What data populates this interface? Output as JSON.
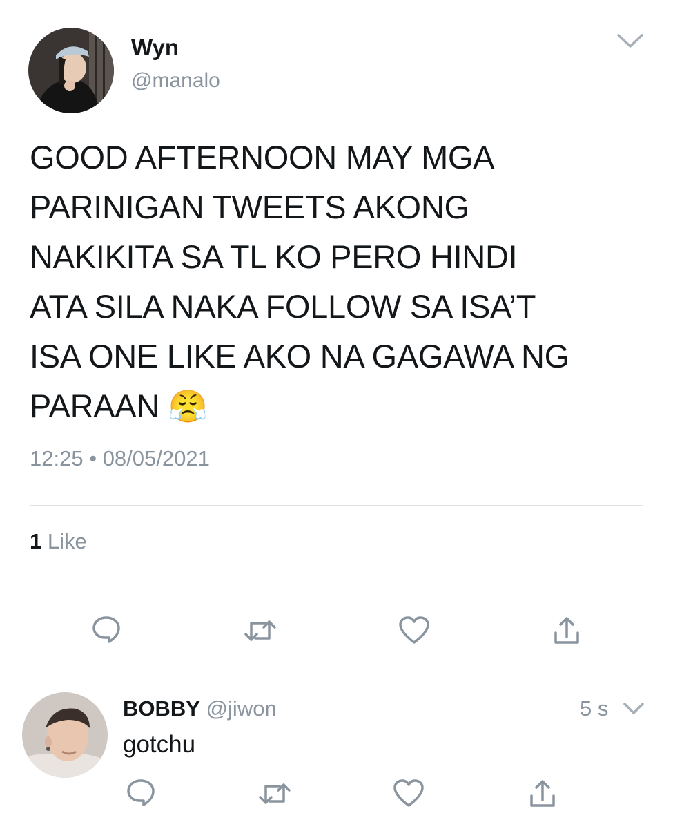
{
  "main_tweet": {
    "author": {
      "display_name": "Wyn",
      "handle": "@manalo"
    },
    "text_lines": [
      "GOOD AFTERNOON MAY MGA",
      "PARINIGAN TWEETS AKONG",
      "NAKIKITA SA TL KO PERO HINDI",
      "ATA SILA NAKA FOLLOW SA ISA’T",
      "ISA ONE LIKE AKO NA GAGAWA NG",
      "PARAAN"
    ],
    "emoji": "😤",
    "time": "12:25",
    "separator": "•",
    "date": "08/05/2021",
    "likes": {
      "count": "1",
      "label": "Like"
    },
    "menu_icon": "chevron-down-icon",
    "actions": [
      "reply-icon",
      "retweet-icon",
      "like-icon",
      "share-icon"
    ]
  },
  "reply": {
    "author": {
      "display_name": "BOBBY",
      "handle": "@jiwon"
    },
    "time_ago": "5 s",
    "text": "gotchu",
    "menu_icon": "chevron-down-icon",
    "actions": [
      "reply-icon",
      "retweet-icon",
      "like-icon",
      "share-icon"
    ]
  },
  "colors": {
    "icon_gray": "#8a949e",
    "text": "#14171a",
    "divider": "#dfe3e8"
  }
}
